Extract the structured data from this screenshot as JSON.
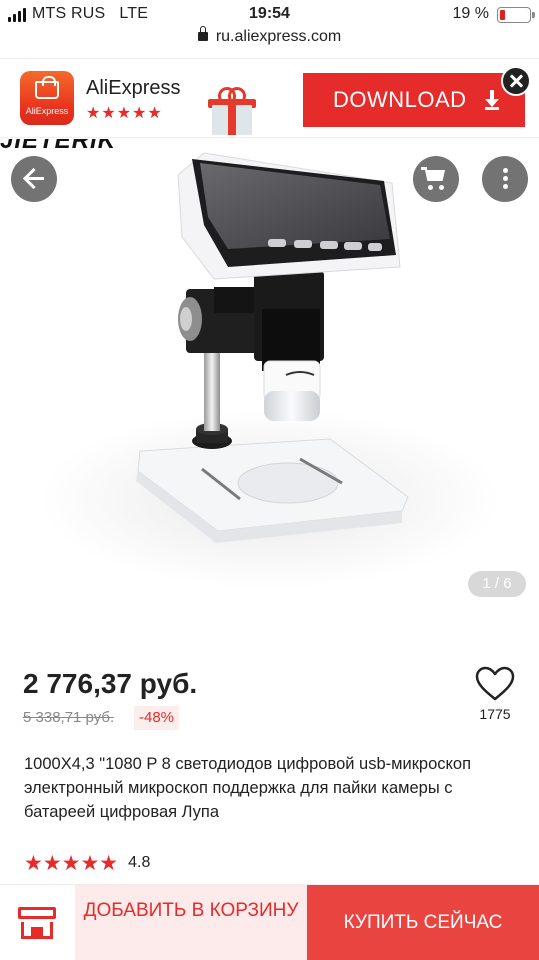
{
  "status_bar": {
    "carrier": "MTS RUS",
    "network": "LTE",
    "time": "19:54",
    "battery": "19 %",
    "battery_level": 0.19
  },
  "url_bar": {
    "url": "ru.aliexpress.com",
    "lock_icon": "lock-icon"
  },
  "app_banner": {
    "app_icon_text": "AliExpress",
    "app_name": "AliExpress",
    "stars": "★★★★★",
    "rating_value": 4.5,
    "download_label": "DOWNLOAD",
    "icons": [
      "download-icon",
      "gift-icon",
      "close-icon"
    ]
  },
  "gallery": {
    "brand_text": "JIETERIK",
    "counter": "1 / 6",
    "icons": [
      "back-arrow-icon",
      "cart-icon",
      "more-vertical-icon"
    ]
  },
  "product": {
    "price": "2 776,37 руб.",
    "old_price": "5 338,71 руб.",
    "discount": "-48%",
    "favorites_count": "1775",
    "title": "1000X4,3 \"1080 P 8 светодиодов цифровой usb-микроскоп электронный микроскоп поддержка для пайки камеры с батареей цифровая Лупа",
    "stars": "★★★★★",
    "rating": "4.8"
  },
  "bottom_bar": {
    "add_to_cart_label": "ДОБАВИТЬ В КОРЗИНУ",
    "buy_now_label": "КУПИТЬ СЕЙЧАС",
    "store_icon": "store-icon"
  },
  "colors": {
    "accent": "#e62b2b",
    "buy_button": "#e9443f",
    "cart_button_bg": "#fdeaea",
    "discount_bg": "#fdeeee"
  }
}
